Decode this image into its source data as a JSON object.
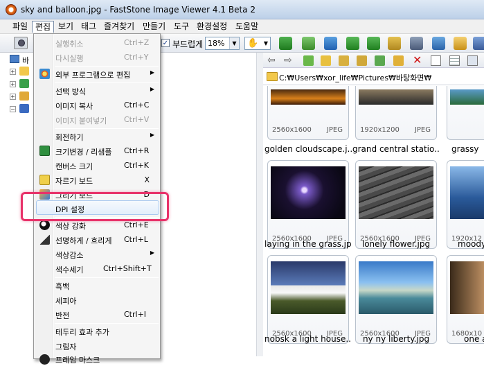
{
  "window": {
    "title": "sky and balloon.jpg  -  FastStone Image Viewer 4.1 Beta 2"
  },
  "menubar": {
    "items": [
      "파일",
      "편집",
      "보기",
      "태그",
      "즐겨찾기",
      "만들기",
      "도구",
      "환경설정",
      "도움말"
    ],
    "active": "편집"
  },
  "toolbar": {
    "smooth_label": "부드럽게",
    "smooth_checked": "✓",
    "zoom_value": "18%"
  },
  "path": {
    "text": "C:₩Users₩xor_life₩Pictures₩바탕화면₩"
  },
  "tree": {
    "root_label": "바"
  },
  "edit_menu": {
    "items": [
      {
        "label": "실행취소",
        "shortcut": "Ctrl+Z",
        "disabled": true
      },
      {
        "label": "다시실행",
        "shortcut": "Ctrl+Y",
        "disabled": true
      },
      {
        "label": "외부 프로그램으로 편집",
        "submenu": true
      },
      {
        "label": "선택 방식",
        "submenu": true
      },
      {
        "label": "이미지 복사",
        "shortcut": "Ctrl+C"
      },
      {
        "label": "이미지 붙여넣기",
        "shortcut": "Ctrl+V",
        "disabled": true
      },
      {
        "label": "회전하기",
        "submenu": true
      },
      {
        "label": "크기변경 / 리샘플",
        "shortcut": "Ctrl+R"
      },
      {
        "label": "캔버스 크기",
        "shortcut": "Ctrl+K"
      },
      {
        "label": "자르기 보드",
        "shortcut": "X"
      },
      {
        "label": "그리기 보드",
        "shortcut": "D"
      },
      {
        "label": "DPI 설정",
        "highlighted": true
      },
      {
        "label": "색상 강화",
        "shortcut": "Ctrl+E"
      },
      {
        "label": "선명하게 / 흐리게",
        "shortcut": "Ctrl+L"
      },
      {
        "label": "색상감소",
        "submenu": true
      },
      {
        "label": "색수세기",
        "shortcut": "Ctrl+Shift+T"
      },
      {
        "label": "흑백"
      },
      {
        "label": "세피아"
      },
      {
        "label": "반전",
        "shortcut": "Ctrl+I"
      },
      {
        "label": "테두리 효과 추가"
      },
      {
        "label": "그림자"
      },
      {
        "label": "프레임 마스크"
      }
    ]
  },
  "thumbnails": [
    {
      "name": "golden cloudscape.j...",
      "dims": "2560x1600",
      "format": "JPEG"
    },
    {
      "name": "grand central statio...",
      "dims": "1920x1200",
      "format": "JPEG"
    },
    {
      "name": "grassy",
      "dims": "",
      "format": ""
    },
    {
      "name": "laying in the grass.jpg",
      "dims": "2560x1600",
      "format": "JPEG"
    },
    {
      "name": "lonely flower.jpg",
      "dims": "2560x1600",
      "format": "JPEG"
    },
    {
      "name": "moody",
      "dims": "1920x12",
      "format": ""
    },
    {
      "name": "nobsk a light house....",
      "dims": "2560x1600",
      "format": "JPEG"
    },
    {
      "name": "ny ny liberty.jpg",
      "dims": "2560x1600",
      "format": "JPEG"
    },
    {
      "name": "one a",
      "dims": "1680x10",
      "format": ""
    }
  ],
  "colors": {
    "highlight_box": "#e8336a",
    "menu_bg": "#f5f5f5",
    "title_bg": "#cddcef"
  }
}
